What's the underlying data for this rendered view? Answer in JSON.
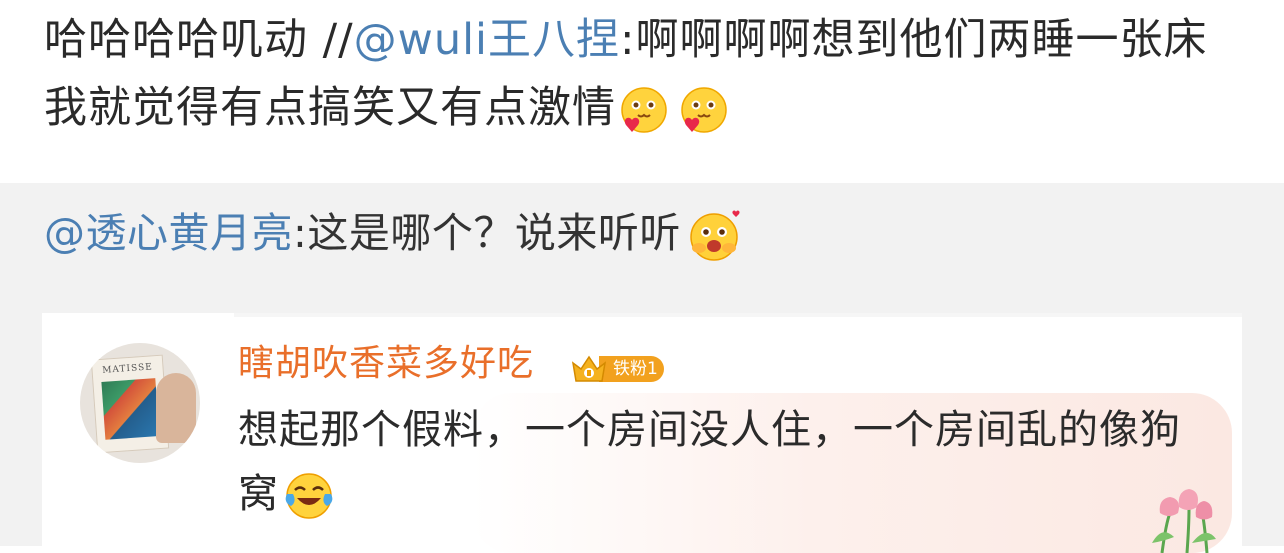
{
  "post": {
    "prefix": "哈哈哈哈叽动 //",
    "mention": "@wuli王八捏",
    "text": ":啊啊啊啊想到他们两睡一张床我就觉得有点搞笑又有点激情",
    "emojis": [
      "love-face-icon",
      "love-face-icon"
    ]
  },
  "quoted": {
    "mention": "@透心黄月亮",
    "text": ":这是哪个？说来听听",
    "emoji": "excited-face-icon"
  },
  "comment": {
    "avatar_book_title": "MATISSE",
    "username": "瞎胡吹香菜多好吃",
    "badge_label": "铁粉1",
    "text": "想起那个假料，一个房间没人住，一个房间乱的像狗窝",
    "emoji": "laugh-cry-icon",
    "decoration": "tulip-flowers-icon"
  },
  "colors": {
    "mention": "#4b7fb3",
    "username": "#e96f2a",
    "badge": "#f2a11e",
    "quoted_bg": "#f2f2f2"
  }
}
